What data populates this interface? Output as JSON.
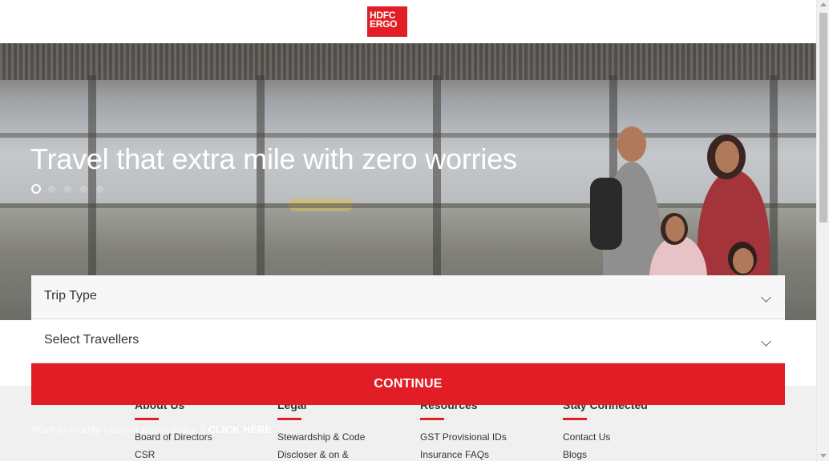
{
  "header": {
    "logo_line1": "HDFC",
    "logo_line2": "ERGO"
  },
  "hero": {
    "title": "Travel that extra mile with zero worries",
    "carousel": {
      "slides": 5,
      "active": 1
    }
  },
  "form": {
    "trip_type_label": "Trip Type",
    "travellers_label": "Select Travellers",
    "continue_label": "CONTINUE"
  },
  "modify_policy": {
    "text": "Want to modify existing travel policy ?",
    "link": "CLICK HERE"
  },
  "footer": {
    "columns": [
      {
        "title": "About Us",
        "links": [
          "Board of Directors",
          "CSR"
        ]
      },
      {
        "title": "Legal",
        "links": [
          "Stewardship & Code",
          "Discloser & on &"
        ]
      },
      {
        "title": "Resources",
        "links": [
          "GST Provisional IDs",
          "Insurance FAQs"
        ]
      },
      {
        "title": "Stay Connected",
        "links": [
          "Contact Us",
          "Blogs"
        ]
      }
    ]
  },
  "colors": {
    "brand_red": "#e21d25",
    "footer_bg": "#f0f0f0"
  }
}
